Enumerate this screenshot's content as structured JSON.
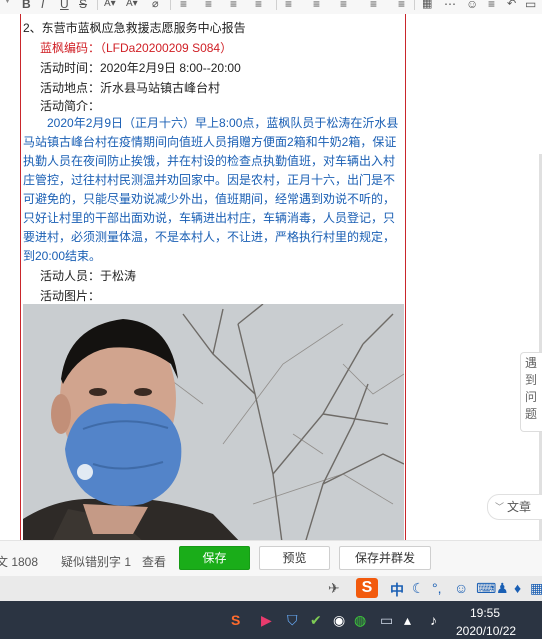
{
  "toolbar": {
    "items": [
      "B",
      "I",
      "U",
      "S"
    ]
  },
  "document": {
    "title": "2、东营市蓝枫应急救援志愿服务中心报告",
    "code": "蓝枫编码：（LFDa20200209  S084）",
    "time": "活动时间：2020年2月9日 8:00--20:00",
    "location": "活动地点：沂水县马站镇古峰台村",
    "intro_label": "活动简介：",
    "intro_lines": [
      "　　2020年2月9日（正月十六）早上8:00点，蓝枫队员于松涛在沂水县",
      "马站镇古峰台村在疫情期间向值班人员捐赠方便面2箱和牛奶2箱，保证",
      "执勤人员在夜间防止挨饿，并在村设的检查点执勤值班，对车辆出入村",
      "庄管控，过往村村民测温并劝回家中。因是农村，正月十六，出门是不",
      "可避免的，只能尽量劝说减少外出，值班期间，经常遇到劝说不听的，",
      "只好让村里的干部出面劝说，车辆进出村庄，车辆消毒，人员登记，只",
      "要进村，必须测量体温，不是本村人，不让进，严格执行村里的规定，",
      "到20:00结束。"
    ],
    "personnel": "活动人员：于松涛",
    "photos_label": "活动图片："
  },
  "side_float": {
    "chars": [
      "遇",
      "到",
      "问",
      "题"
    ]
  },
  "article_pill": "文章",
  "bottom_bar": {
    "word_count": "文 1808",
    "typo_label": "疑似错别字 1",
    "view_link": "查看",
    "save": "保存",
    "preview": "预览",
    "save_mass": "保存并群发"
  },
  "tray": {
    "ime_lang": "中",
    "time": "19:55",
    "date": "2020/10/22"
  }
}
